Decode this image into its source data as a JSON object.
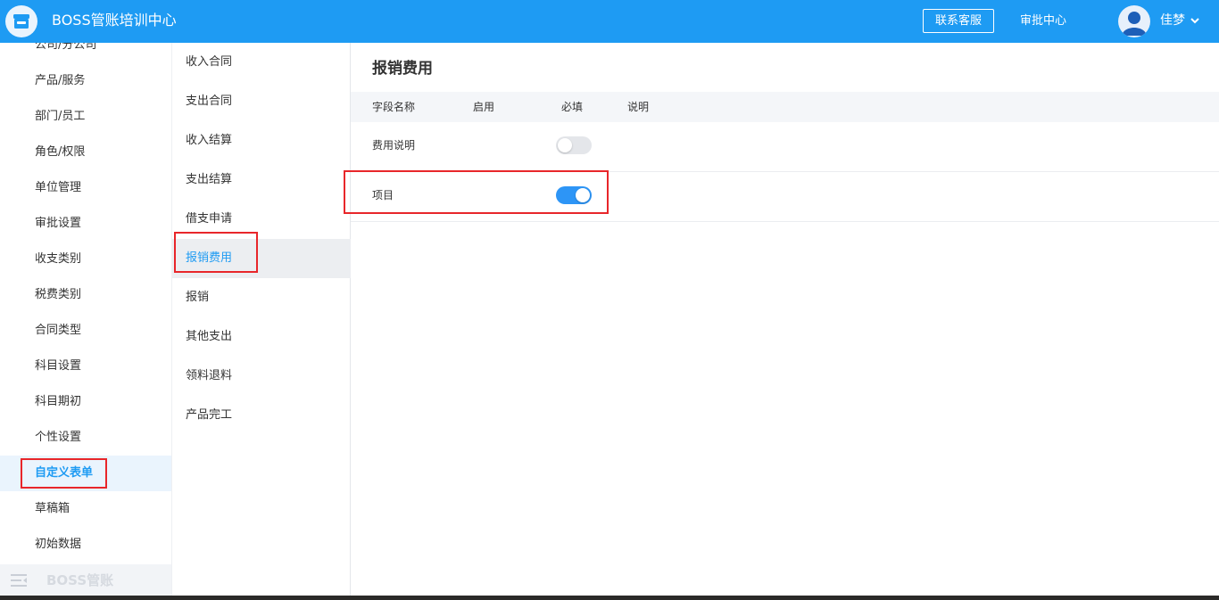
{
  "header": {
    "app_title": "BOSS管账培训中心",
    "contact_label": "联系客服",
    "approval_label": "审批中心",
    "user_name": "佳梦"
  },
  "sidebar": {
    "items": [
      {
        "label": "公司/分公司"
      },
      {
        "label": "产品/服务"
      },
      {
        "label": "部门/员工"
      },
      {
        "label": "角色/权限"
      },
      {
        "label": "单位管理"
      },
      {
        "label": "审批设置"
      },
      {
        "label": "收支类别"
      },
      {
        "label": "税费类别"
      },
      {
        "label": "合同类型"
      },
      {
        "label": "科目设置"
      },
      {
        "label": "科目期初"
      },
      {
        "label": "个性设置"
      },
      {
        "label": "自定义表单",
        "active": true
      },
      {
        "label": "草稿箱"
      },
      {
        "label": "初始数据"
      }
    ],
    "footer_label": "BOSS管账"
  },
  "submenu": {
    "items": [
      {
        "label": "收入合同"
      },
      {
        "label": "支出合同"
      },
      {
        "label": "收入结算"
      },
      {
        "label": "支出结算"
      },
      {
        "label": "借支申请"
      },
      {
        "label": "报销费用",
        "active": true
      },
      {
        "label": "报销"
      },
      {
        "label": "其他支出"
      },
      {
        "label": "领料退料"
      },
      {
        "label": "产品完工"
      }
    ]
  },
  "main": {
    "title": "报销费用",
    "columns": [
      "字段名称",
      "启用",
      "必填",
      "说明"
    ],
    "rows": [
      {
        "name": "费用说明",
        "enabled": false
      },
      {
        "name": "项目",
        "enabled": true
      }
    ]
  },
  "colors": {
    "header_bg": "#1e9bf3",
    "accent": "#1e9bf3",
    "toggle_on": "#2d95f6",
    "highlight": "#e8262a"
  },
  "icons": {
    "logo": "store-icon",
    "avatar": "user-avatar-icon",
    "caret": "chevron-down-icon",
    "collapse": "menu-collapse-icon"
  }
}
